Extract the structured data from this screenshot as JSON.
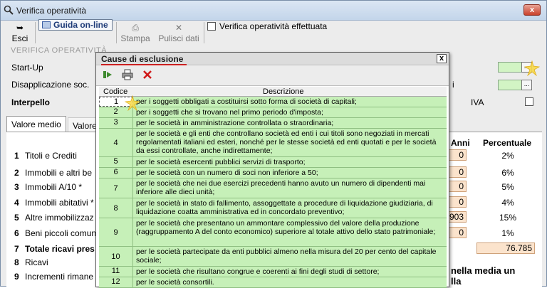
{
  "window": {
    "title": "Verifica operatività"
  },
  "toolbar": {
    "esci": "Esci",
    "guida": "Guida on-line",
    "stampa": "Stampa",
    "pulisci": "Pulisci dati",
    "verifica_check_label": "Verifica operatività effettuata"
  },
  "group": {
    "title": "VERIFICA OPERATIVITÀ",
    "startup": "Start-Up",
    "disapplicazione": "Disapplicazione soc.",
    "interpello": "Interpello",
    "iva": "IVA"
  },
  "tabs": [
    {
      "label": "Valore medio"
    },
    {
      "label": "Valore"
    }
  ],
  "table": {
    "col_anni": "Anni",
    "col_percentuale": "Percentuale",
    "rows": [
      {
        "n": "1",
        "label": "Titoli e Crediti",
        "anni": "0",
        "perc": "2%"
      },
      {
        "n": "2",
        "label": "Immobili e altri be",
        "anni": "0",
        "perc": "6%"
      },
      {
        "n": "3",
        "label": "Immobili A/10 *",
        "anni": "0",
        "perc": "5%"
      },
      {
        "n": "4",
        "label": "Immobili abitativi *",
        "anni": "0",
        "perc": "4%"
      },
      {
        "n": "5",
        "label": "Altre immobilizzaz",
        "anni": "903",
        "perc": "15%"
      },
      {
        "n": "6",
        "label": "Beni piccoli comuni",
        "anni": "0",
        "perc": "1%"
      },
      {
        "n": "7",
        "label": "Totale ricavi pres",
        "total": "76.785"
      },
      {
        "n": "8",
        "label": "Ricavi"
      },
      {
        "n": "9",
        "label": "Incrementi rimane"
      }
    ],
    "note": "nella media un",
    "note2": "lla"
  },
  "dialog": {
    "title": "Cause di esclusione",
    "close": "x",
    "col_codice": "Codice",
    "col_descrizione": "Descrizione",
    "rows": [
      {
        "code": "1",
        "desc": "per i soggetti obbligati a costituirsi sotto forma di società di capitali;"
      },
      {
        "code": "2",
        "desc": "per i soggetti che si trovano nel primo periodo d'imposta;"
      },
      {
        "code": "3",
        "desc": "per le società in amministrazione controllata o straordinaria;"
      },
      {
        "code": "4",
        "desc": "per le società e gli enti che controllano società ed enti i cui titoli sono negoziati in mercati regolamentati italiani ed esteri, nonché per le stesse società ed enti quotati e per le società da essi controllate, anche indirettamente;"
      },
      {
        "code": "5",
        "desc": "per le società esercenti pubblici servizi di trasporto;"
      },
      {
        "code": "6",
        "desc": "per le società con un numero di soci non inferiore a 50;"
      },
      {
        "code": "7",
        "desc": "per le società che nei due esercizi precedenti hanno avuto un numero di dipendenti mai inferiore alle dieci unità;"
      },
      {
        "code": "8",
        "desc": "per le società in stato di fallimento, assoggettate a procedure di liquidazione giudiziaria, di liquidazione coatta amministrativa ed in concordato preventivo;"
      },
      {
        "code": "9",
        "desc": "per le società che presentano un ammontare complessivo del valore della produzione (raggruppamento A del conto economico) superiore al totale attivo dello stato patrimoniale;"
      },
      {
        "code": "10",
        "desc": "per le società partecipate da enti pubblici almeno nella misura del 20 per cento del capitale sociale;"
      },
      {
        "code": "11",
        "desc": "per le società che risultano congrue e coerenti ai fini degli studi di settore;"
      },
      {
        "code": "12",
        "desc": "per le società consortili."
      }
    ]
  },
  "colors": {
    "grid_green": "#c6f0b8",
    "field_orange": "#fbe3cc",
    "accent_red": "#c81e1e"
  }
}
